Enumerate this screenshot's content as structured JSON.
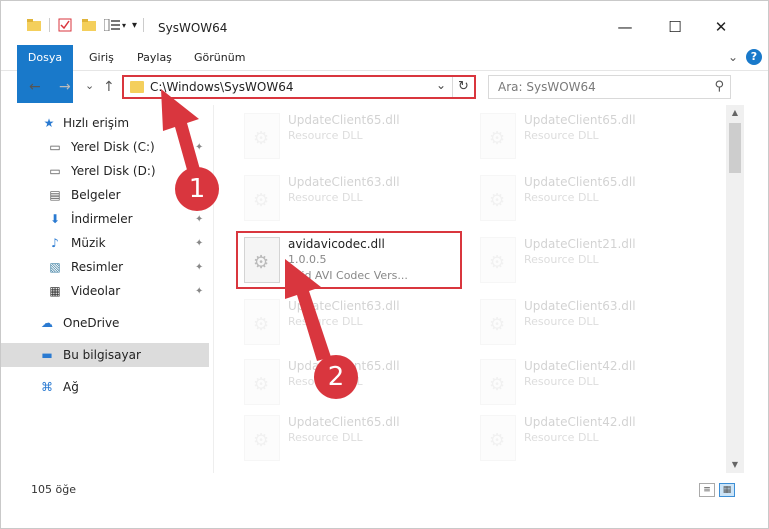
{
  "window": {
    "title": "SysWOW64"
  },
  "titlebar": {
    "minimize": "—",
    "maximize": "☐",
    "close": "✕"
  },
  "ribbon": {
    "tabs": [
      "Dosya",
      "Giriş",
      "Paylaş",
      "Görünüm"
    ],
    "help": "?",
    "expand": "⌄"
  },
  "nav": {
    "back": "←",
    "forward": "→",
    "recent": "⌄",
    "up": "↑",
    "address": "C:\\Windows\\SysWOW64",
    "dropdown": "⌄",
    "refresh": "↻"
  },
  "search": {
    "placeholder": "Ara: SysWOW64",
    "icon": "search-icon"
  },
  "sidebar": {
    "items": [
      {
        "label": "Hızlı erişim",
        "icon": "star-icon",
        "glyph": "★",
        "pinned": false
      },
      {
        "label": "Yerel Disk (C:)",
        "icon": "drive-icon",
        "glyph": "▭",
        "pinned": true
      },
      {
        "label": "Yerel Disk (D:)",
        "icon": "drive-icon",
        "glyph": "▭",
        "pinned": true
      },
      {
        "label": "Belgeler",
        "icon": "document-icon",
        "glyph": "▤",
        "pinned": true
      },
      {
        "label": "İndirmeler",
        "icon": "download-icon",
        "glyph": "⬇",
        "pinned": true
      },
      {
        "label": "Müzik",
        "icon": "music-icon",
        "glyph": "♪",
        "pinned": true
      },
      {
        "label": "Resimler",
        "icon": "pictures-icon",
        "glyph": "▧",
        "pinned": true
      },
      {
        "label": "Videolar",
        "icon": "video-icon",
        "glyph": "▦",
        "pinned": true
      },
      {
        "label": "OneDrive",
        "icon": "cloud-icon",
        "glyph": "☁",
        "pinned": false
      },
      {
        "label": "Bu bilgisayar",
        "icon": "computer-icon",
        "glyph": "▬",
        "pinned": false
      },
      {
        "label": "Ağ",
        "icon": "network-icon",
        "glyph": "⌘",
        "pinned": false
      }
    ],
    "pin_glyph": "📌"
  },
  "files": [
    {
      "name": "UpdateClient65.dll",
      "sub": "Resource DLL",
      "faded": true
    },
    {
      "name": "UpdateClient65.dll",
      "sub": "Resource DLL",
      "faded": true
    },
    {
      "name": "UpdateClient63.dll",
      "sub": "Resource DLL",
      "faded": true
    },
    {
      "name": "UpdateClient65.dll",
      "sub": "Resource DLL",
      "faded": true
    },
    {
      "name": "avidavicodec.dll",
      "sub": "1.0.0.5",
      "desc": "Avid AVI Codec Vers...",
      "faded": false
    },
    {
      "name": "UpdateClient21.dll",
      "sub": "Resource DLL",
      "faded": true
    },
    {
      "name": "UpdateClient63.dll",
      "sub": "Resource DLL",
      "faded": true
    },
    {
      "name": "UpdateClient63.dll",
      "sub": "Resource DLL",
      "faded": true
    },
    {
      "name": "UpdateClient65.dll",
      "sub": "Resource DLL",
      "faded": true
    },
    {
      "name": "UpdateClient42.dll",
      "sub": "Resource DLL",
      "faded": true
    },
    {
      "name": "UpdateClient65.dll",
      "sub": "Resource DLL",
      "faded": true
    },
    {
      "name": "UpdateClient42.dll",
      "sub": "Resource DLL",
      "faded": true
    }
  ],
  "status": {
    "count": "105 öğe"
  },
  "callouts": [
    "1",
    "2"
  ],
  "colors": {
    "accent": "#1979ca",
    "callout": "#d9363e",
    "folder": "#f4cf5c"
  }
}
